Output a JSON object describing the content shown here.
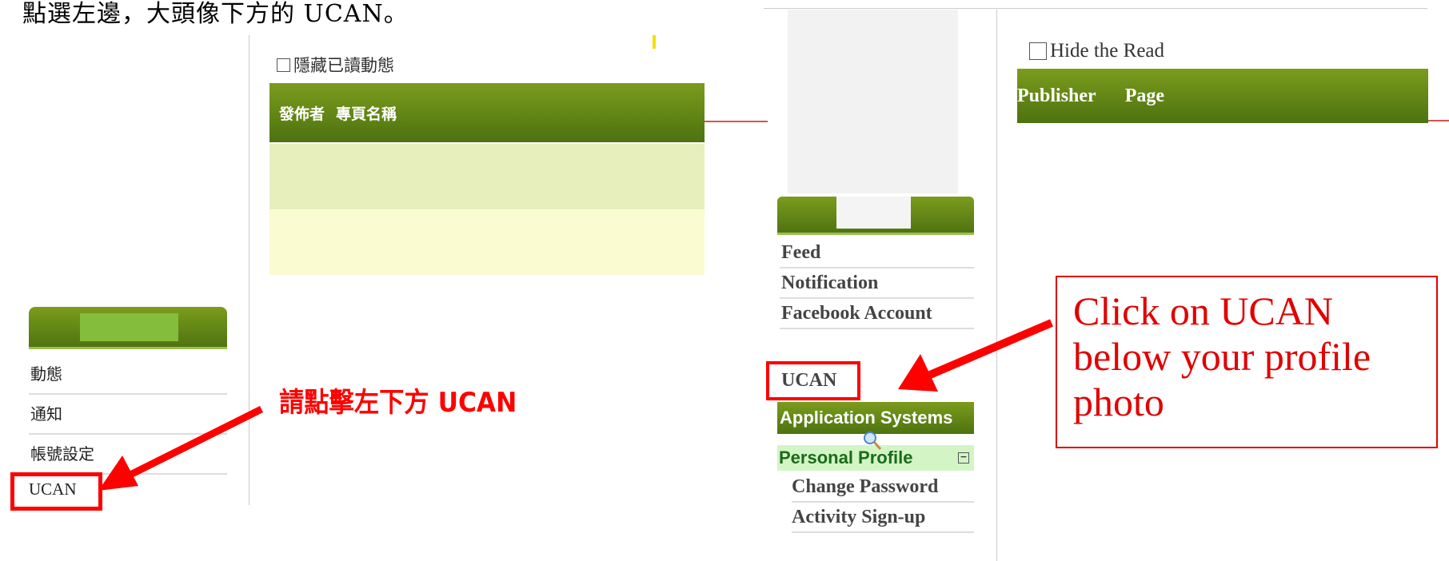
{
  "left_panel": {
    "instruction_heading": "點選左邊，大頭像下方的 UCAN。",
    "hide_read_checkbox_label": "隱藏已讀動態",
    "table_header": {
      "publisher": "發佈者",
      "page_name": "專頁名稱"
    },
    "sidebar_menu": [
      "動態",
      "通知",
      "帳號設定"
    ],
    "ucan_label": "UCAN",
    "annotation": "請點擊左下方 UCAN"
  },
  "right_panel": {
    "hide_read_checkbox_label": "Hide the Read",
    "table_header": {
      "publisher": "Publisher",
      "page_name": "Page"
    },
    "sidebar_menu": [
      "Feed",
      "Notification",
      "Facebook Account"
    ],
    "ucan_label": "UCAN",
    "application_systems_label": "Application Systems",
    "personal_profile_label": "Personal Profile",
    "personal_profile_toggle": "−",
    "submenu": [
      "Change Password",
      "Activity Sign-up"
    ],
    "annotation": "Click on UCAN below your profile photo"
  },
  "colors": {
    "accent_red": "#ff0000",
    "header_green": "#5a8215",
    "row_light_green": "#e7efbd",
    "row_light_yellow": "#fbfbd1",
    "profile_green_bg": "#d3f5c6"
  },
  "icons": {
    "arrow_left": "red-arrow-icon",
    "magnifier": "magnifier-icon",
    "collapse": "collapse-toggle-icon"
  }
}
